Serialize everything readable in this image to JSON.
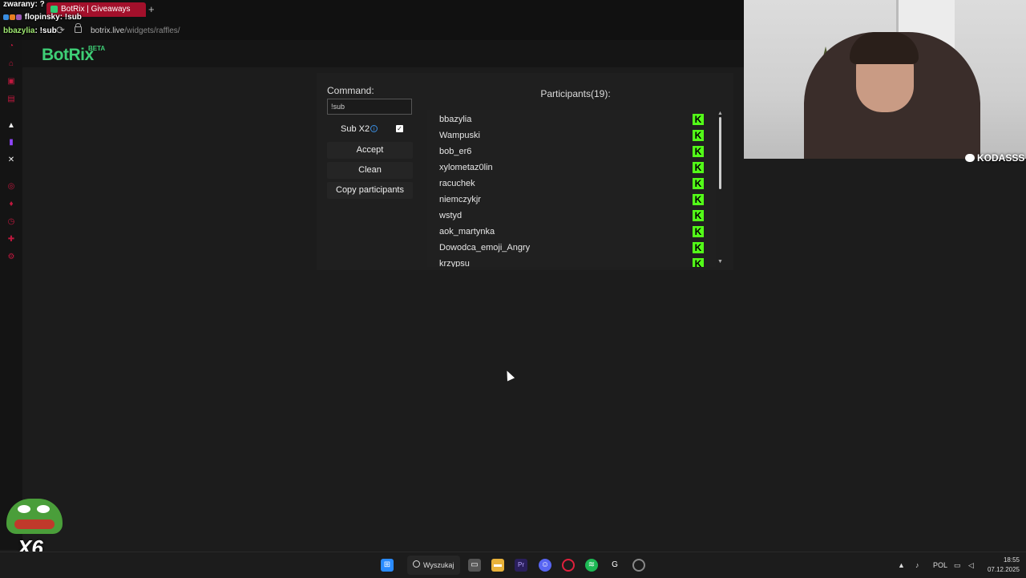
{
  "browser": {
    "tab_title": "BotRix | Giveaways",
    "new_tab": "+",
    "url_host": "botrix.live",
    "url_path": "/widgets/raffles/"
  },
  "chat_overlay": [
    {
      "user": "zwarany",
      "message": ": ?"
    },
    {
      "user": "flopinsky",
      "message": ": !sub"
    },
    {
      "user": "bbazylia",
      "message": ": !sub"
    }
  ],
  "app": {
    "logo": "BotRix",
    "beta": "BETA"
  },
  "form": {
    "command_label": "Command:",
    "command_value": "!sub",
    "sub_x2_label": "Sub X2",
    "sub_x2_checked": true,
    "accept_label": "Accept",
    "clean_label": "Clean",
    "copy_label": "Copy participants"
  },
  "participants": {
    "title": "Participants(19):",
    "platform_icon": "kick-icon",
    "kick_color": "#53fc18",
    "list": [
      "bbazylia",
      "Wampuski",
      "bob_er6",
      "xylometaz0lin",
      "racuchek",
      "niemczykjr",
      "wstyd",
      "aok_martynka",
      "Dowodca_emoji_Angry",
      "krzypsu"
    ]
  },
  "webcam": {
    "discord_name": "KODASSS"
  },
  "overlay": {
    "emote_count": "X6"
  },
  "taskbar": {
    "search_label": "Wyszukaj",
    "language": "POL",
    "time": "18:55",
    "date": "07.12.2025"
  }
}
